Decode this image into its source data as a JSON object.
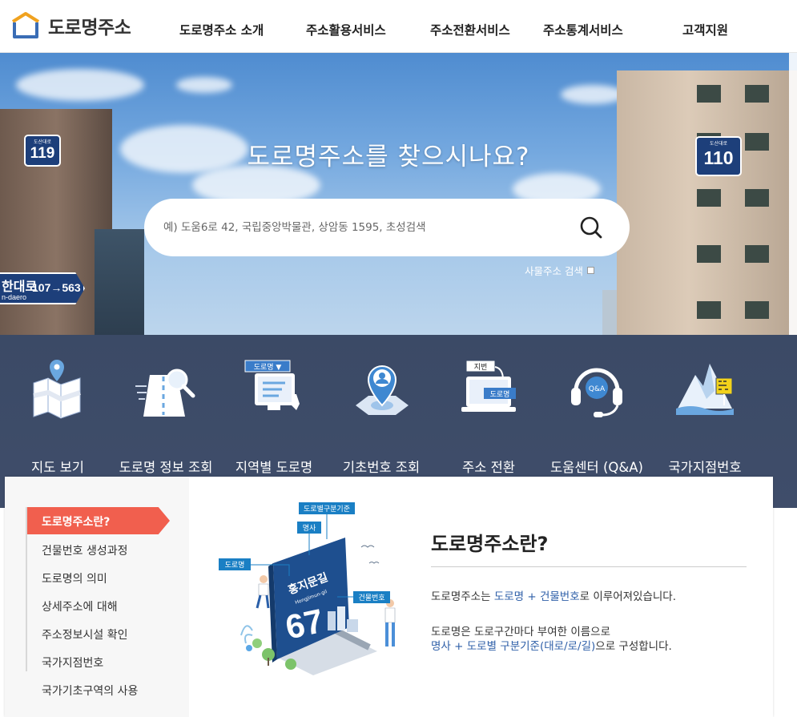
{
  "header": {
    "logo_text": "도로명주소",
    "nav": [
      "도로명주소 소개",
      "주소활용서비스",
      "주소전환서비스",
      "주소통계서비스",
      "고객지원"
    ]
  },
  "hero": {
    "title": "도로명주소를 찾으시나요?",
    "search_placeholder": "예) 도움6로 42, 국립중앙박물관, 상암동 1595, 초성검색",
    "thing_search_label": "사물주소 검색",
    "signs": {
      "left_small": "도산대로",
      "left_num": "119",
      "right_small": "도산대로",
      "right_num": "110",
      "arrow_name": "한대로",
      "arrow_eng": "n-daero",
      "arrow_num": "107→563"
    }
  },
  "quick_menu": [
    {
      "label": "지도 보기",
      "icon": "map-icon"
    },
    {
      "label": "도로명 정보 조회",
      "icon": "road-search-icon"
    },
    {
      "label": "지역별 도로명",
      "icon": "region-road-icon"
    },
    {
      "label": "기초번호 조회",
      "icon": "basic-number-icon"
    },
    {
      "label": "주소 전환",
      "icon": "address-convert-icon"
    },
    {
      "label": "도움센터 (Q&A)",
      "icon": "help-headset-icon"
    },
    {
      "label": "국가지점번호",
      "icon": "national-point-icon"
    }
  ],
  "quick_icon_texts": {
    "region_select": "도로명 ▼",
    "convert_top": "지번",
    "convert_bottom": "도로명",
    "qa": "Q&A"
  },
  "sidemenu": {
    "active": "도로명주소란?",
    "items": [
      "건물번호 생성과정",
      "도로명의 의미",
      "상세주소에 대해",
      "주소정보시설 확인",
      "국가지점번호",
      "국가기초구역의 사용"
    ]
  },
  "illustration": {
    "tag_standard": "도로별구분기준",
    "tag_name": "명사",
    "tag_road": "도로명",
    "tag_building": "건물번호",
    "sign_name": "홍지문길",
    "sign_eng": "Hongjimun-gil",
    "sign_num": "67"
  },
  "content": {
    "title": "도로명주소란?",
    "line1_prefix": "도로명주소는 ",
    "line1_highlight": "도로명 + 건물번호",
    "line1_suffix": "로 이루어져있습니다.",
    "line2": "도로명은 도로구간마다 부여한 이름으로",
    "line3_highlight": "명사 + 도로별 구분기준(대로/로/길)",
    "line3_suffix": "으로 구성합니다."
  },
  "colors": {
    "accent": "#f15f4e",
    "quick_bg": "#3b4a66",
    "sign_blue": "#1d3f7a",
    "highlight": "#2e5fa8",
    "tag_blue": "#1a7fc4"
  }
}
